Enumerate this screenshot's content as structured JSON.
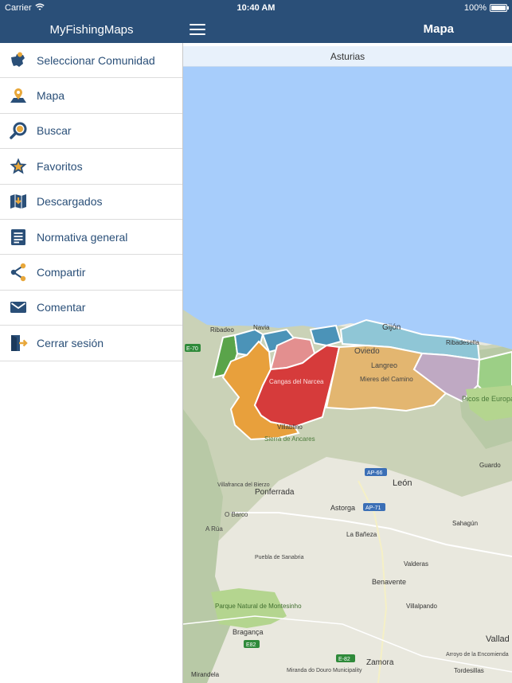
{
  "status_bar": {
    "carrier": "Carrier",
    "time": "10:40 AM",
    "battery_percent": "100%",
    "battery_level": 1.0
  },
  "sidebar": {
    "title": "MyFishingMaps",
    "items": [
      {
        "label": "Seleccionar Comunidad",
        "icon": "community-map-icon"
      },
      {
        "label": "Mapa",
        "icon": "map-pin-icon"
      },
      {
        "label": "Buscar",
        "icon": "search-icon"
      },
      {
        "label": "Favoritos",
        "icon": "star-icon"
      },
      {
        "label": "Descargados",
        "icon": "download-map-icon"
      },
      {
        "label": "Normativa general",
        "icon": "document-icon"
      },
      {
        "label": "Compartir",
        "icon": "share-icon"
      },
      {
        "label": "Comentar",
        "icon": "mail-icon"
      },
      {
        "label": "Cerrar sesión",
        "icon": "logout-icon"
      }
    ]
  },
  "header": {
    "title": "Mapa"
  },
  "region_bar": {
    "label": "Asturias"
  },
  "map": {
    "labels": {
      "gijon": "Gijón",
      "oviedo": "Oviedo",
      "langreo": "Langreo",
      "mieres": "Mieres del Camino",
      "cangas": "Cangas del Narcea",
      "ribadesella": "Ribadesella",
      "ribadeo": "Ribadeo",
      "navia": "Navia",
      "leon": "León",
      "ponferrada": "Ponferrada",
      "astorga": "Astorga",
      "la_baneza": "La Bañeza",
      "benavente": "Benavente",
      "zamora": "Zamora",
      "braganca": "Bragança",
      "sahagun": "Sahagún",
      "guardo": "Guardo",
      "villafranca": "Villafranca del Bierzo",
      "barco": "O Barco",
      "a_rua": "A Rúa",
      "puebla_sanabria": "Puebla de Sanabria",
      "valderas": "Valderas",
      "villalpando": "Villalpando",
      "mirandela": "Mirandela",
      "miranda_douro": "Miranda do Douro Municipality",
      "arroyo": "Arroyo de la Encomienda",
      "tordesillas": "Tordesillas",
      "villablino": "Villablino",
      "picos": "Picos de Europa",
      "montesinho": "Parque Natural de Montesinho",
      "ancares": "Sierra de Ancares",
      "valladolid": "Vallad",
      "road_e70": "E-70",
      "road_ap66": "AP-66",
      "road_ap71": "AP-71",
      "road_e82a": "E82",
      "road_e82b": "E-82"
    },
    "zone_colors": {
      "sea": "#a7cdfb",
      "land": "#e9e8de",
      "mountain": "#b8c9a6",
      "green": "#5aa44a",
      "teal": "#4b93b8",
      "light_teal": "#8fc6d6",
      "orange": "#e8a03c",
      "red": "#d63b3b",
      "pink": "#e38f8f",
      "sand": "#e3b670",
      "lilac": "#bfa9c3",
      "park": "#b4d58f"
    }
  }
}
